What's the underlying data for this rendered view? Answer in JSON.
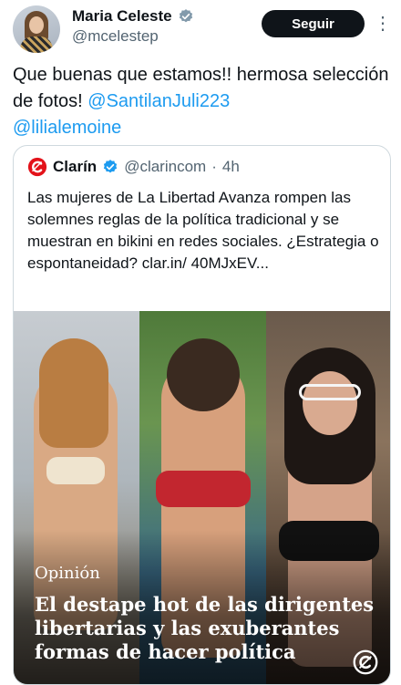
{
  "author": {
    "display_name": "Maria Celeste",
    "handle": "@mcelestep",
    "verified_icon": "verified-badge-icon"
  },
  "actions": {
    "follow_label": "Seguir",
    "more_icon": "more-options-icon"
  },
  "tweet": {
    "text_before": "Que buenas que estamos!!  hermosa selección de fotos! ",
    "mention_1": "@SantilanJuli223",
    "mention_2": "@lilialemoine"
  },
  "quoted": {
    "account_name": "Clarín",
    "handle": "@clarincom",
    "separator": "·",
    "time": "4h",
    "text": "Las mujeres de La Libertad Avanza rompen las solemnes reglas de la política tradicional y se muestran en bikini en redes sociales. ¿Estrategia o espontaneidad? clar.in/ 40MJxEV...",
    "media": {
      "section": "Opinión",
      "headline": "El destape hot de las dirigentes libertarias y las exuberantes formas de hacer política"
    }
  },
  "colors": {
    "accent": "#1d9bf0",
    "text": "#0f1419",
    "muted": "#536471",
    "border": "#cfd9de",
    "clarin_red": "#e3121a"
  }
}
